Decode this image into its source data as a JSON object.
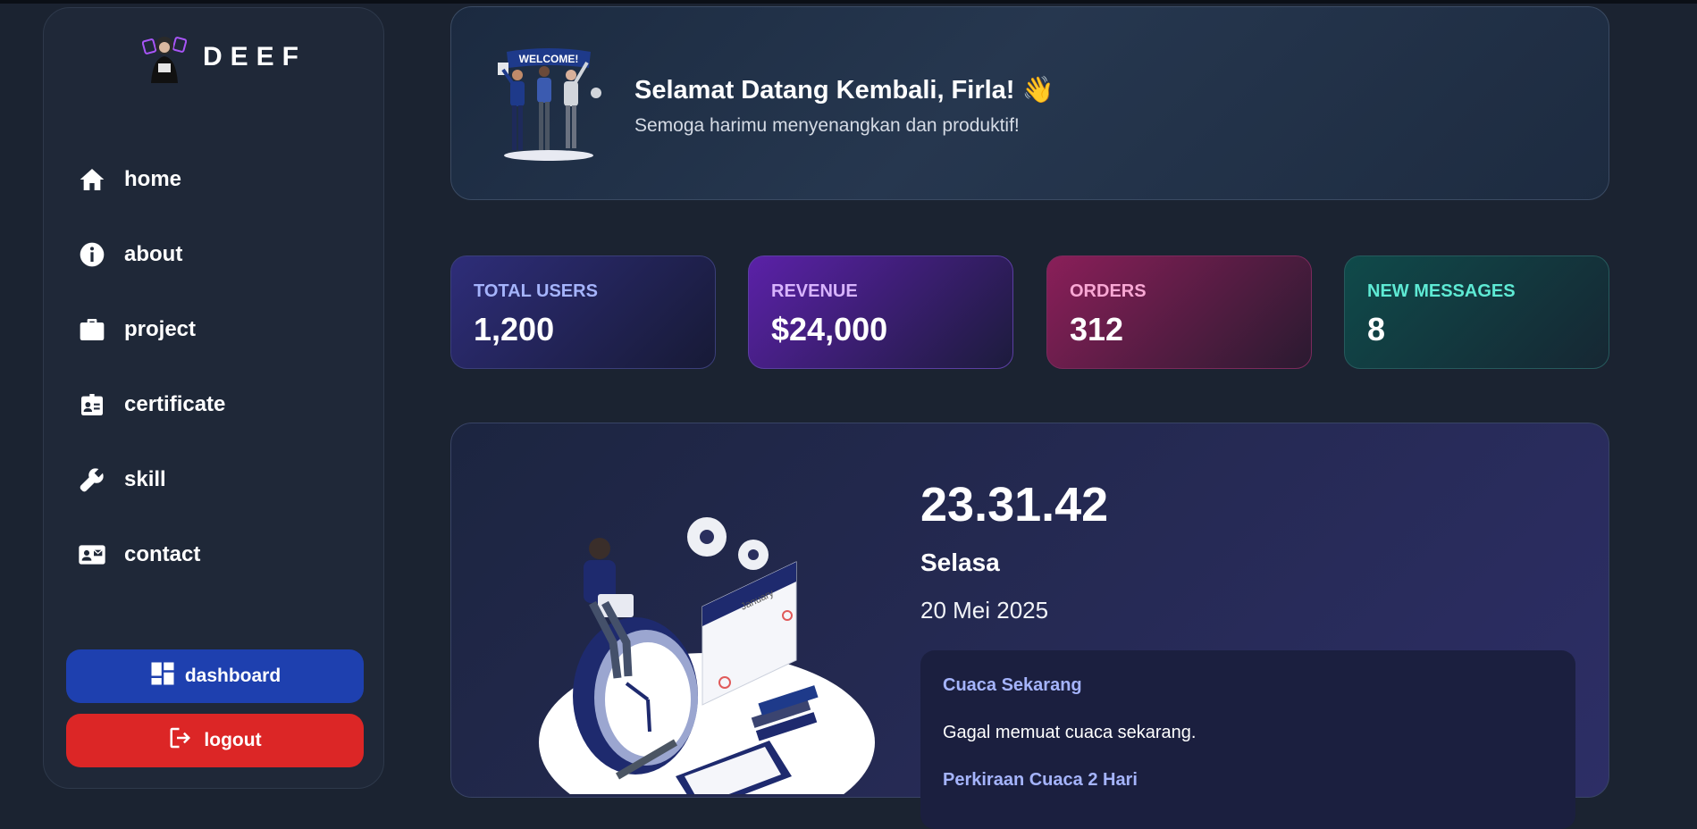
{
  "brand": {
    "name": "DEEF"
  },
  "sidebar": {
    "items": [
      {
        "label": "home",
        "icon": "home-icon"
      },
      {
        "label": "about",
        "icon": "info-icon"
      },
      {
        "label": "project",
        "icon": "briefcase-icon"
      },
      {
        "label": "certificate",
        "icon": "id-badge-icon"
      },
      {
        "label": "skill",
        "icon": "wrench-icon"
      },
      {
        "label": "contact",
        "icon": "contact-card-icon"
      }
    ],
    "dashboard_label": "dashboard",
    "logout_label": "logout"
  },
  "welcome": {
    "banner_text": "WELCOME!",
    "title": "Selamat Datang Kembali, Firla! 👋",
    "subtitle": "Semoga harimu menyenangkan dan produktif!"
  },
  "stats": [
    {
      "label": "TOTAL USERS",
      "value": "1,200"
    },
    {
      "label": "REVENUE",
      "value": "$24,000"
    },
    {
      "label": "ORDERS",
      "value": "312"
    },
    {
      "label": "NEW MESSAGES",
      "value": "8"
    }
  ],
  "clock": {
    "time": "23.31.42",
    "day": "Selasa",
    "date": "20 Mei 2025",
    "calendar_month": "January"
  },
  "weather": {
    "title": "Cuaca Sekarang",
    "message": "Gagal memuat cuaca sekarang.",
    "forecast_title": "Perkiraan Cuaca 2 Hari"
  },
  "colors": {
    "background": "#1b2331",
    "dashboard_button": "#1e40af",
    "logout_button": "#dc2626"
  }
}
